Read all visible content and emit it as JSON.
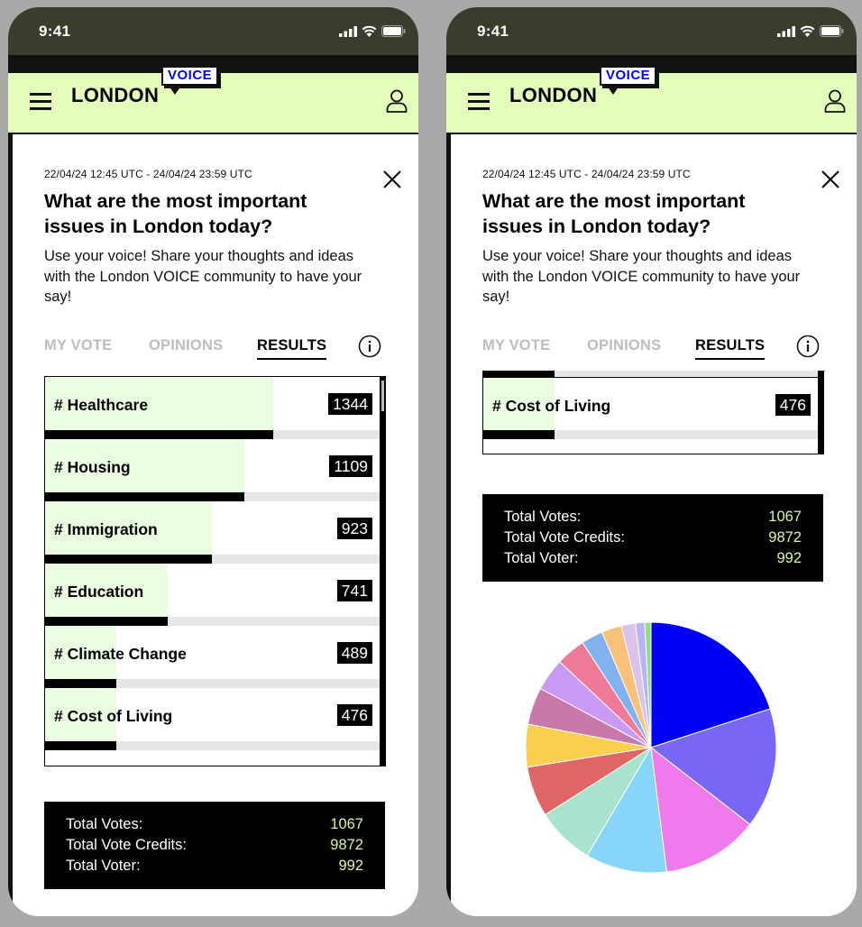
{
  "status_bar": {
    "time": "9:41"
  },
  "brand": {
    "word": "LONDON",
    "badge": "VOICE"
  },
  "poll": {
    "date_range": "22/04/24 12:45 UTC - 24/04/24 23:59 UTC",
    "title": "What are the most important issues in London today?",
    "description": "Use your voice! Share your thoughts and ideas with the London VOICE community to have your say!"
  },
  "tabs": [
    {
      "label": "MY VOTE",
      "active": false
    },
    {
      "label": "OPINIONS",
      "active": false
    },
    {
      "label": "RESULTS",
      "active": true
    }
  ],
  "results": [
    {
      "label": "# Healthcare",
      "count": "1344",
      "share": 0.67
    },
    {
      "label": "# Housing",
      "count": "1109",
      "share": 0.585
    },
    {
      "label": "# Immigration",
      "count": "923",
      "share": 0.49
    },
    {
      "label": "# Education",
      "count": "741",
      "share": 0.36
    },
    {
      "label": "# Climate Change",
      "count": "489",
      "share": 0.21
    },
    {
      "label": "# Cost of Living",
      "count": "476",
      "share": 0.21
    }
  ],
  "totals": [
    {
      "label": "Total Votes:",
      "value": "1067"
    },
    {
      "label": "Total Vote Credits:",
      "value": "9872"
    },
    {
      "label": "Total Voter:",
      "value": "992"
    }
  ],
  "chart_data": {
    "type": "pie",
    "slices": [
      {
        "value": 20,
        "color": "#0000f5"
      },
      {
        "value": 15.5,
        "color": "#7866f5"
      },
      {
        "value": 12.5,
        "color": "#ee7aed"
      },
      {
        "value": 10.5,
        "color": "#87d5f8"
      },
      {
        "value": 7.5,
        "color": "#a8e3cd"
      },
      {
        "value": 6.5,
        "color": "#e06666"
      },
      {
        "value": 5.5,
        "color": "#f9d04e"
      },
      {
        "value": 4.8,
        "color": "#c978ab"
      },
      {
        "value": 4.2,
        "color": "#c899f5"
      },
      {
        "value": 3.8,
        "color": "#ee7a98"
      },
      {
        "value": 2.8,
        "color": "#82b1f0"
      },
      {
        "value": 2.6,
        "color": "#f9c17a"
      },
      {
        "value": 1.8,
        "color": "#dbc2e9"
      },
      {
        "value": 1.2,
        "color": "#b7b3f5"
      },
      {
        "value": 0.8,
        "color": "#8ee07a"
      }
    ]
  }
}
